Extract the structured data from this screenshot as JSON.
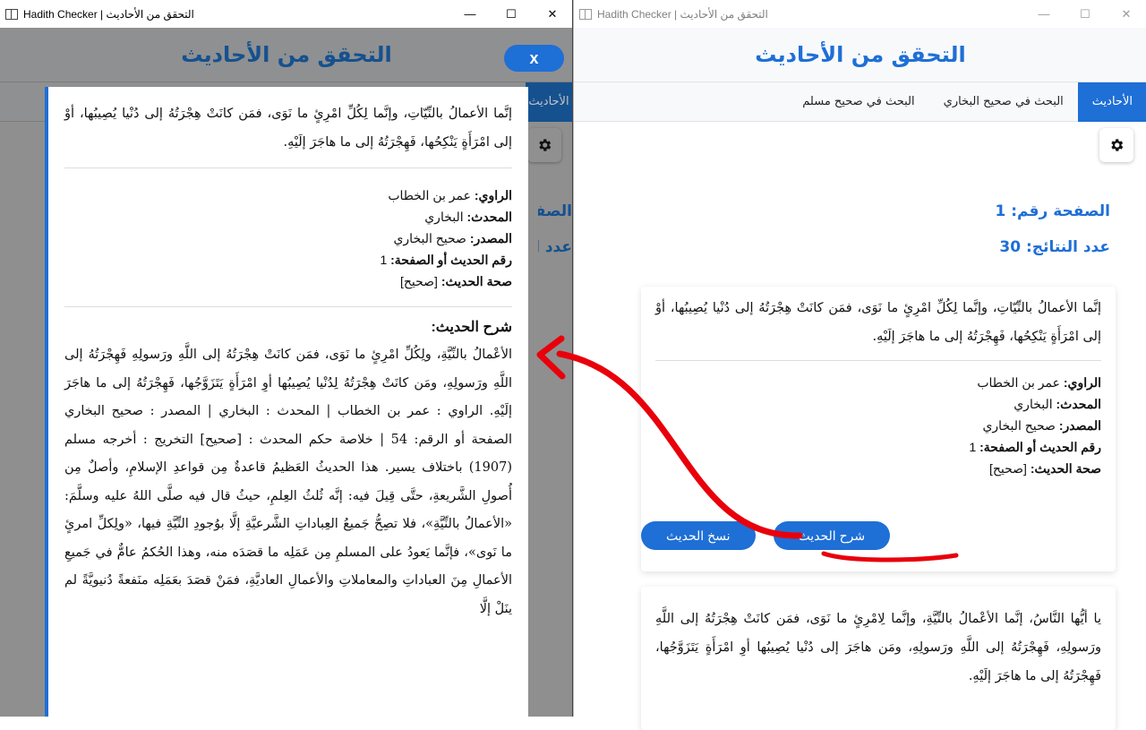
{
  "window_title": "Hadith Checker | التحقق من الأحاديث",
  "header_title": "التحقق من الأحاديث",
  "tabs": [
    "الأحاديث",
    "البحث في صحيح البخاري",
    "البحث في صحيح مسلم"
  ],
  "tab_fragment": "الأحاديث",
  "page_number": "الصفحة رقم: 1",
  "results_count": "عدد النتائج: 30",
  "close_label": "x",
  "hadith1": {
    "text": "إنَّما الأعمالُ بالنِّيّاتِ، وإنَّما لِكُلِّ امْرِئٍ ما نَوَى، فمَن كانَتْ هِجْرَتُهُ إلى دُنْيا يُصِيبُها، أوْ إلى امْرَأَةٍ يَنْكِحُها، فَهِجْرَتُهُ إلى ما هاجَرَ إلَيْهِ.",
    "narrator_label": "الراوي:",
    "narrator": "عمر بن الخطاب",
    "scholar_label": "المحدث:",
    "scholar": "البخاري",
    "source_label": "المصدر:",
    "source": "صحيح البخاري",
    "number_label": "رقم الحديث أو الصفحة:",
    "number": "1",
    "grade_label": "صحة الحديث:",
    "grade": "[صحيح]",
    "copy_button": "نسخ الحديث",
    "explain_button": "شرح الحديث"
  },
  "hadith2": {
    "text": "يا أيُّها النَّاسُ، إنَّما الأعْمالُ بالنِّيَّةِ، وإنَّما لِامْرِئٍ ما نَوَى، فمَن كانَتْ هِجْرَتُهُ إلى اللَّهِ ورَسولِهِ، فَهِجْرَتُهُ إلى اللَّهِ ورَسولِهِ، ومَن هاجَرَ إلى دُنْيا يُصِيبُها أوِ امْرَأَةٍ يَتَزَوَّجُها، فَهِجْرَتُهُ إلى ما هاجَرَ إلَيْهِ."
  },
  "modal": {
    "sharh_title": "شرح الحديث:",
    "sharh_text": "الأعْمالُ بالنِّيَّةِ، ولِكُلِّ امْرِئٍ ما نَوَى، فمَن كانَتْ هِجْرَتُهُ إلى اللَّهِ ورَسولِهِ فَهِجْرَتُهُ إلى اللَّهِ ورَسولِهِ، ومَن كانَتْ هِجْرَتُهُ لِدُنْيا يُصِيبُها أوِ امْرَأَةٍ يَتَزَوَّجُها، فَهِجْرَتُهُ إلى ما هاجَرَ إلَيْهِ. الراوي : عمر بن الخطاب | المحدث : البخاري | المصدر : صحيح البخاري الصفحة أو الرقم: 54 | خلاصة حكم المحدث : [صحيح] التخريج : أخرجه مسلم (1907) باختلاف يسير. هذا الحديثُ العَظيمُ قاعدةٌ مِن قواعدِ الإسلامِ، وأصلٌ مِن أُصولِ الشَّريعةِ، حتَّى قِيلَ فيه: إنَّه ثُلثُ العِلمِ، حيثُ قال فيه صلَّى اللهُ عليه وسلَّمَ: «الأعمالُ بالنِّيَّةِ»، فلا تصِحُّ جَميعُ العِباداتِ الشَّرعيَّةِ إلَّا بوُجودِ النِّيَّةِ فيها، «ولِكلِّ امرئٍ ما نَوى»، فإنَّما يَعودُ على المسلمِ مِن عَمَلِه ما قصَدَه منه، وهذا الحُكمُ عامٌّ في جَميعِ الأعمالِ مِنَ العباداتِ والمعاملاتِ والأعمالِ العاديَّةِ، فمَنْ قصَدَ بعَمَلِه منَفعةً دُنيويَّةً لم ينَلْ إلَّا"
  },
  "colors": {
    "accent": "#1e6fd6",
    "annotation": "#e8000b"
  }
}
